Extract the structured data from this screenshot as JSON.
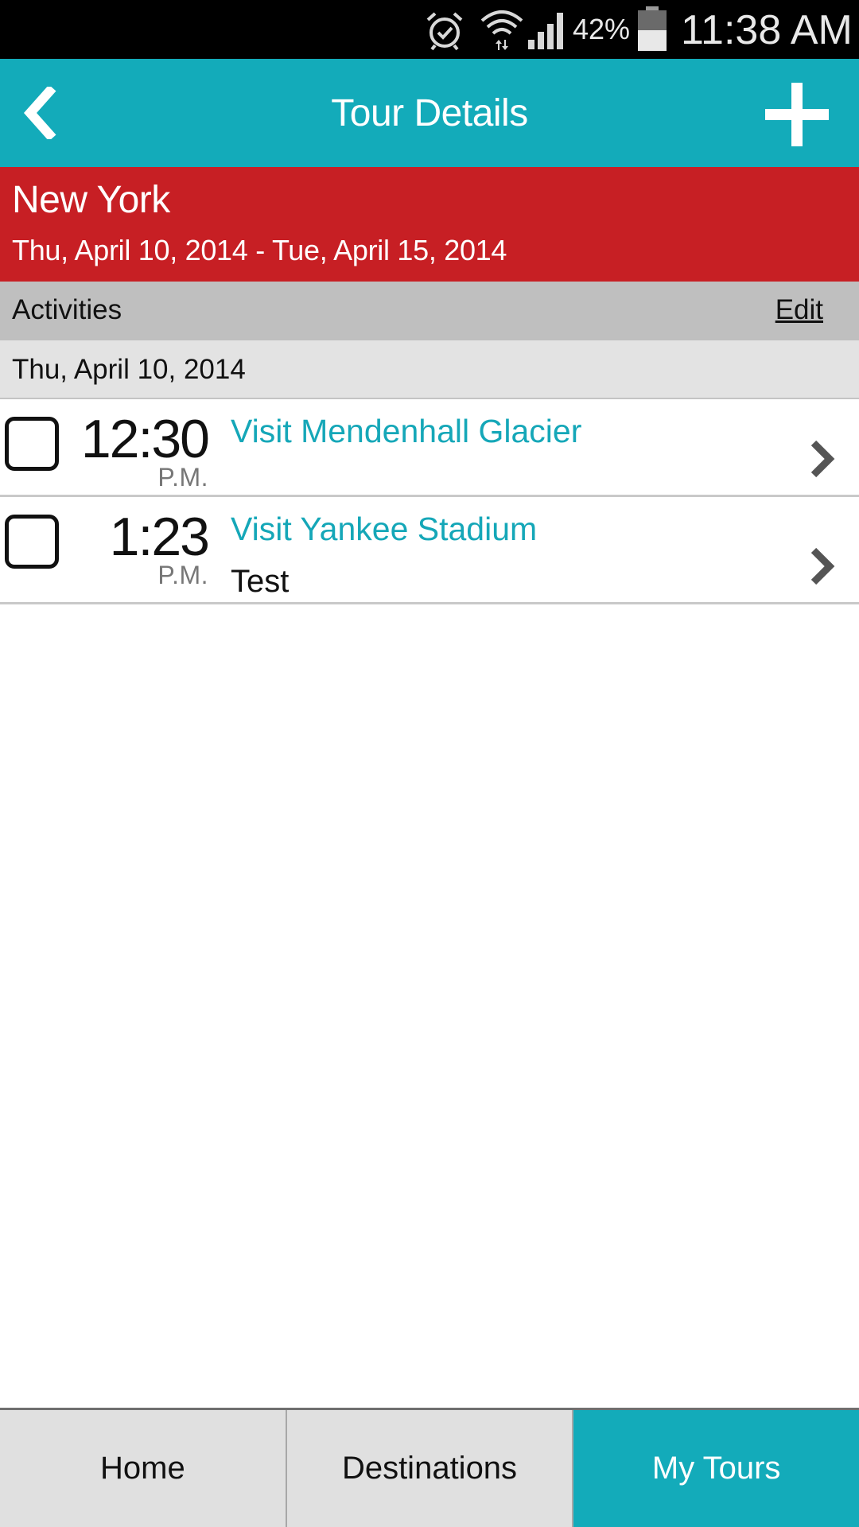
{
  "status_bar": {
    "battery_percent": "42%",
    "time": "11:38 AM",
    "icons": [
      "alarm-icon",
      "wifi-icon",
      "signal-icon",
      "battery-icon"
    ]
  },
  "header": {
    "title": "Tour Details",
    "back_icon": "chevron-left-icon",
    "add_icon": "plus-icon",
    "background_color": "#13abba"
  },
  "tour": {
    "city": "New York",
    "dates": "Thu, April 10, 2014 - Tue, April 15, 2014",
    "background_color": "#c71f24"
  },
  "activities_section": {
    "label": "Activities",
    "edit_label": "Edit"
  },
  "day": {
    "date": "Thu, April 10, 2014"
  },
  "activities": [
    {
      "time": "12:30",
      "ampm": "P.M.",
      "name": "Visit Mendenhall Glacier",
      "note": "",
      "checked": false
    },
    {
      "time": "1:23",
      "ampm": "P.M.",
      "name": "Visit Yankee Stadium",
      "note": "Test",
      "checked": false
    }
  ],
  "tabs": [
    {
      "label": "Home",
      "active": false
    },
    {
      "label": "Destinations",
      "active": false
    },
    {
      "label": "My Tours",
      "active": true
    }
  ]
}
